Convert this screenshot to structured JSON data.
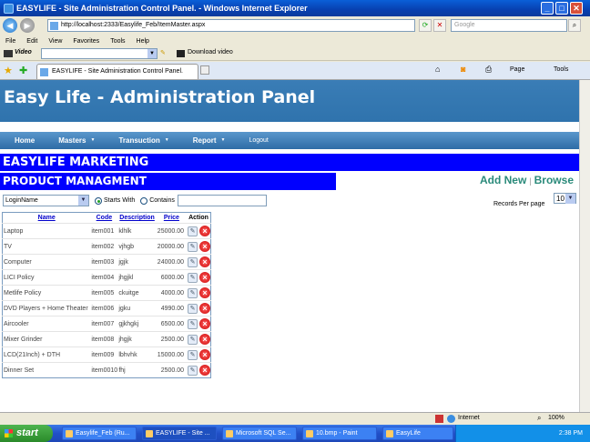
{
  "window": {
    "title": "EASYLIFE - Site Administration Control Panel. - Windows Internet Explorer",
    "address": "http://localhost:2333/Easylife_Feb/ItemMaster.aspx",
    "search_placeholder": "Google",
    "menu": [
      "File",
      "Edit",
      "View",
      "Favorites",
      "Tools",
      "Help"
    ],
    "video_label": "Video",
    "download_label": "Download video",
    "tab_title": "EASYLIFE - Site Administration Control Panel.",
    "cmd_page": "Page",
    "cmd_tools": "Tools"
  },
  "page": {
    "header_title": "Easy Life - Administration Panel",
    "nav": [
      {
        "label": "Home"
      },
      {
        "label": "Masters"
      },
      {
        "label": "Transuction"
      },
      {
        "label": "Report"
      },
      {
        "label": "Logout"
      }
    ],
    "banner": "EASYLIFE MARKETING",
    "section_title": "PRODUCT MANAGMENT",
    "add_new": "Add New",
    "link_sep": "|",
    "browse": "Browse",
    "filter": {
      "field": "LoginName",
      "starts_with": "Starts With",
      "contains": "Contains",
      "search_value": ""
    },
    "records_per_page_label": "Records Per page",
    "records_per_page": "10",
    "grid": {
      "headers": [
        "Name",
        "Code",
        "Description",
        "Price",
        "Action"
      ],
      "rows": [
        [
          "Laptop",
          "item001",
          "klhlk",
          "25000.00"
        ],
        [
          "TV",
          "item002",
          "vjhgb",
          "20000.00"
        ],
        [
          "Computer",
          "item003",
          "jgjk",
          "24000.00"
        ],
        [
          "LICI Policy",
          "item004",
          "jhgjkl",
          "6000.00"
        ],
        [
          "Metlife Policy",
          "item005",
          "ckuitge",
          "4000.00"
        ],
        [
          "DVD Players + Home Theater",
          "item006",
          "jgku",
          "4990.00"
        ],
        [
          "Aircooler",
          "item007",
          "gjkhgkj",
          "6500.00"
        ],
        [
          "Mixer Grinder",
          "item008",
          "jhgjk",
          "2500.00"
        ],
        [
          "LCD(21Inch) + DTH",
          "item009",
          "lbhvhk",
          "15000.00"
        ],
        [
          "Dinner Set",
          "item0010",
          "fhj",
          "2500.00"
        ]
      ]
    }
  },
  "status": {
    "zone": "Internet",
    "zoom": "100%"
  },
  "taskbar": {
    "start": "start",
    "tasks": [
      "Easylife_Feb (Ru...",
      "EASYLIFE - Site ...",
      "Microsoft SQL Se...",
      "10.bmp - Paint",
      "EasyLife"
    ],
    "clock": "2:38 PM"
  }
}
